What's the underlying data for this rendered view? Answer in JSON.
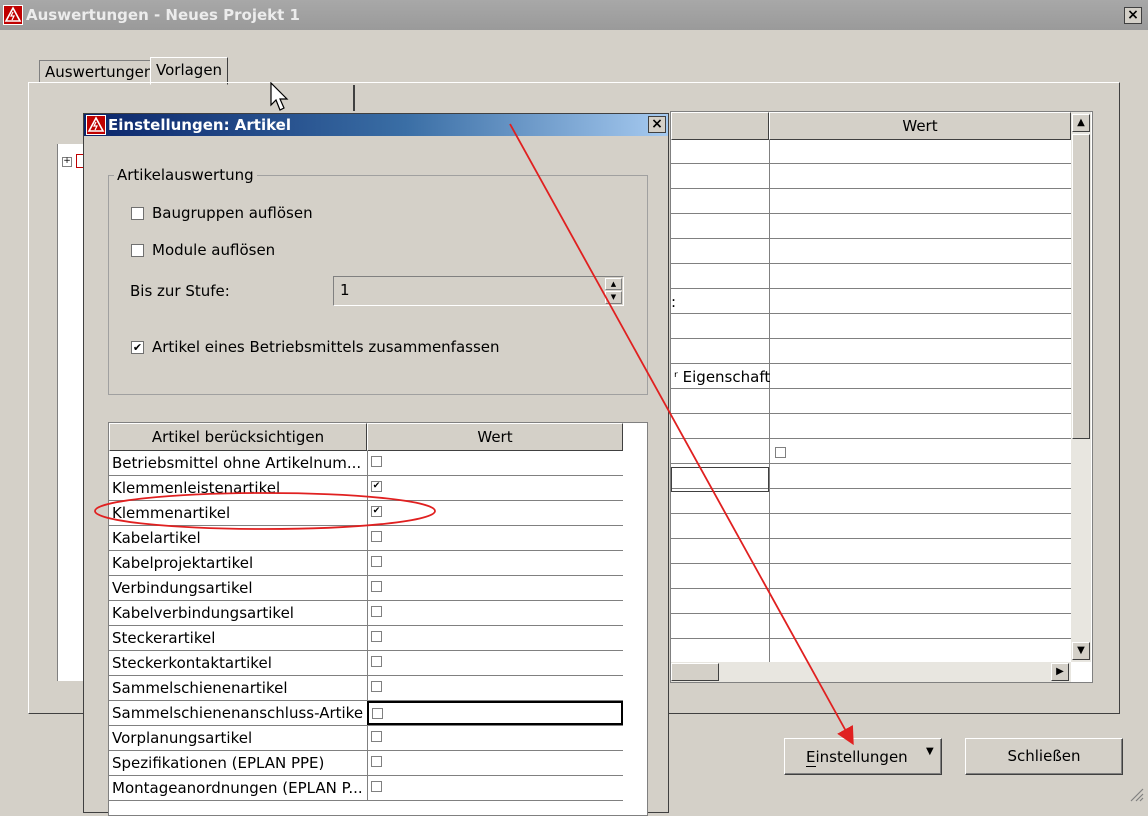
{
  "main_window": {
    "title": "Auswertungen - Neues Projekt 1",
    "tabs": [
      {
        "label": "Auswertungen"
      },
      {
        "label": "Vorlagen"
      }
    ],
    "background_grid": {
      "header_value": "Wert",
      "partial_label_eigenschaft": "Eigenschaft",
      "partial_colon": ":"
    },
    "buttons": {
      "settings": "Einstellungen",
      "close": "Schließen"
    }
  },
  "dialog": {
    "title": "Einstellungen: Artikel",
    "group_title": "Artikelauswertung",
    "options": [
      {
        "label": "Baugruppen auflösen",
        "checked": false
      },
      {
        "label": "Module auflösen",
        "checked": false
      }
    ],
    "level_label": "Bis zur Stufe:",
    "level_value": "1",
    "combine_option": {
      "label": "Artikel eines Betriebsmittels zusammenfassen",
      "checked": true
    },
    "list": {
      "col_name": "Artikel berücksichtigen",
      "col_value": "Wert",
      "rows": [
        {
          "name": "Betriebsmittel ohne Artikelnum...",
          "checked": false
        },
        {
          "name": "Klemmenleistenartikel",
          "checked": true
        },
        {
          "name": "Klemmenartikel",
          "checked": true
        },
        {
          "name": "Kabelartikel",
          "checked": false
        },
        {
          "name": "Kabelprojektartikel",
          "checked": false
        },
        {
          "name": "Verbindungsartikel",
          "checked": false
        },
        {
          "name": "Kabelverbindungsartikel",
          "checked": false
        },
        {
          "name": "Steckerartikel",
          "checked": false
        },
        {
          "name": "Steckerkontaktartikel",
          "checked": false
        },
        {
          "name": "Sammelschienenartikel",
          "checked": false
        },
        {
          "name": "Sammelschienenanschluss-Artikel",
          "checked": false
        },
        {
          "name": "Vorplanungsartikel",
          "checked": false
        },
        {
          "name": "Spezifikationen (EPLAN PPE)",
          "checked": false
        },
        {
          "name": "Montageanordnungen (EPLAN P...",
          "checked": false
        }
      ]
    }
  },
  "colors": {
    "annotation_red": "#e02020",
    "dialog_title_start": "#0a246a",
    "dialog_title_end": "#a6caf0"
  }
}
